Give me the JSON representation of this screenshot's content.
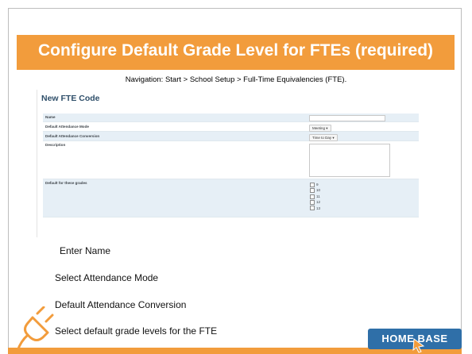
{
  "slide": {
    "title": "Configure Default Grade Level for FTEs (required)",
    "navigation": "Navigation: Start > School Setup > Full-Time Equivalencies (FTE)."
  },
  "form": {
    "heading": "New FTE Code",
    "name_label": "Name",
    "name_value": "",
    "attendance_mode_label": "Default Attendance Mode",
    "attendance_mode_value": "Meeting",
    "attendance_conversion_label": "Default Attendance Conversion",
    "attendance_conversion_value": "Time to Day",
    "description_label": "Description",
    "description_value": "",
    "grades_label": "Default for these grades",
    "grades": [
      "9",
      "10",
      "11",
      "12",
      "13"
    ]
  },
  "instructions": [
    "Enter Name",
    "Select Attendance Mode",
    "Default Attendance Conversion",
    "Select default grade levels for the FTE"
  ],
  "branding": {
    "logo_text": "HOME BASE",
    "accent_color": "#f29c3c",
    "logo_color": "#2f6fa8"
  }
}
